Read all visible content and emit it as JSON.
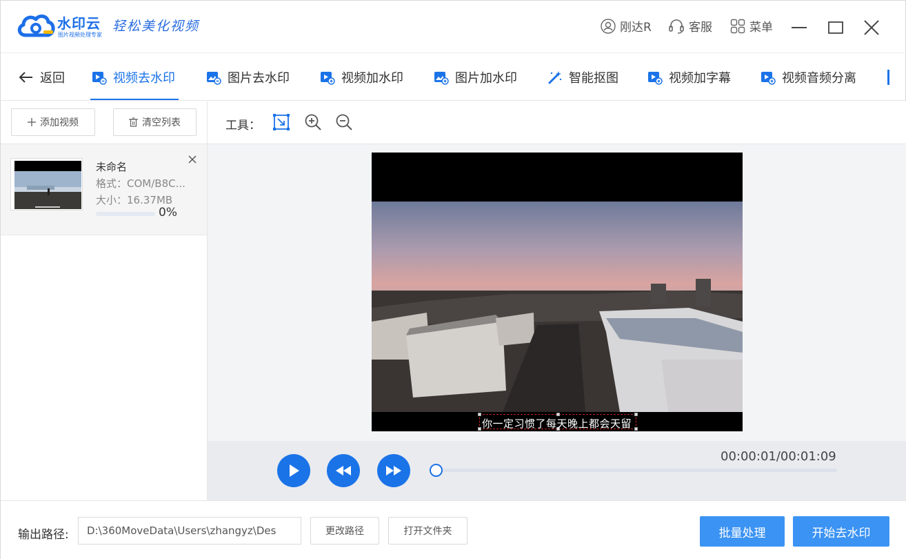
{
  "header": {
    "brand_name": "水印云",
    "brand_sub": "图片视频处理专家",
    "slogan": "轻松美化视频",
    "user_name": "刚达R",
    "support_label": "客服",
    "menu_label": "菜单"
  },
  "tabs": {
    "back_label": "返回",
    "items": [
      {
        "label": "视频去水印",
        "active": true
      },
      {
        "label": "图片去水印"
      },
      {
        "label": "视频加水印"
      },
      {
        "label": "图片加水印"
      },
      {
        "label": "智能抠图"
      },
      {
        "label": "视频加字幕"
      },
      {
        "label": "视频音频分离"
      }
    ]
  },
  "left_panel": {
    "add_video_label": "添加视频",
    "clear_list_label": "清空列表",
    "files": [
      {
        "name": "未命名",
        "format": "格式：COM/B8C...",
        "size": "大小：16.37MB",
        "progress_percent": 0,
        "progress_text": "0%"
      }
    ]
  },
  "tools": {
    "label": "工具："
  },
  "preview": {
    "subtitle": "你一定习惯了每天晚上都会天留"
  },
  "player": {
    "timecode": "00:00:01/00:01:09",
    "progress_fraction": 0.01
  },
  "bottom": {
    "output_label": "输出路径:",
    "output_path": "D:\\360MoveData\\Users\\zhangyz\\Des",
    "change_path_label": "更改路径",
    "open_folder_label": "打开文件夹",
    "batch_label": "批量处理",
    "start_label": "开始去水印"
  },
  "colors": {
    "accent": "#1b73e8",
    "button_blue": "#3b93f3"
  }
}
